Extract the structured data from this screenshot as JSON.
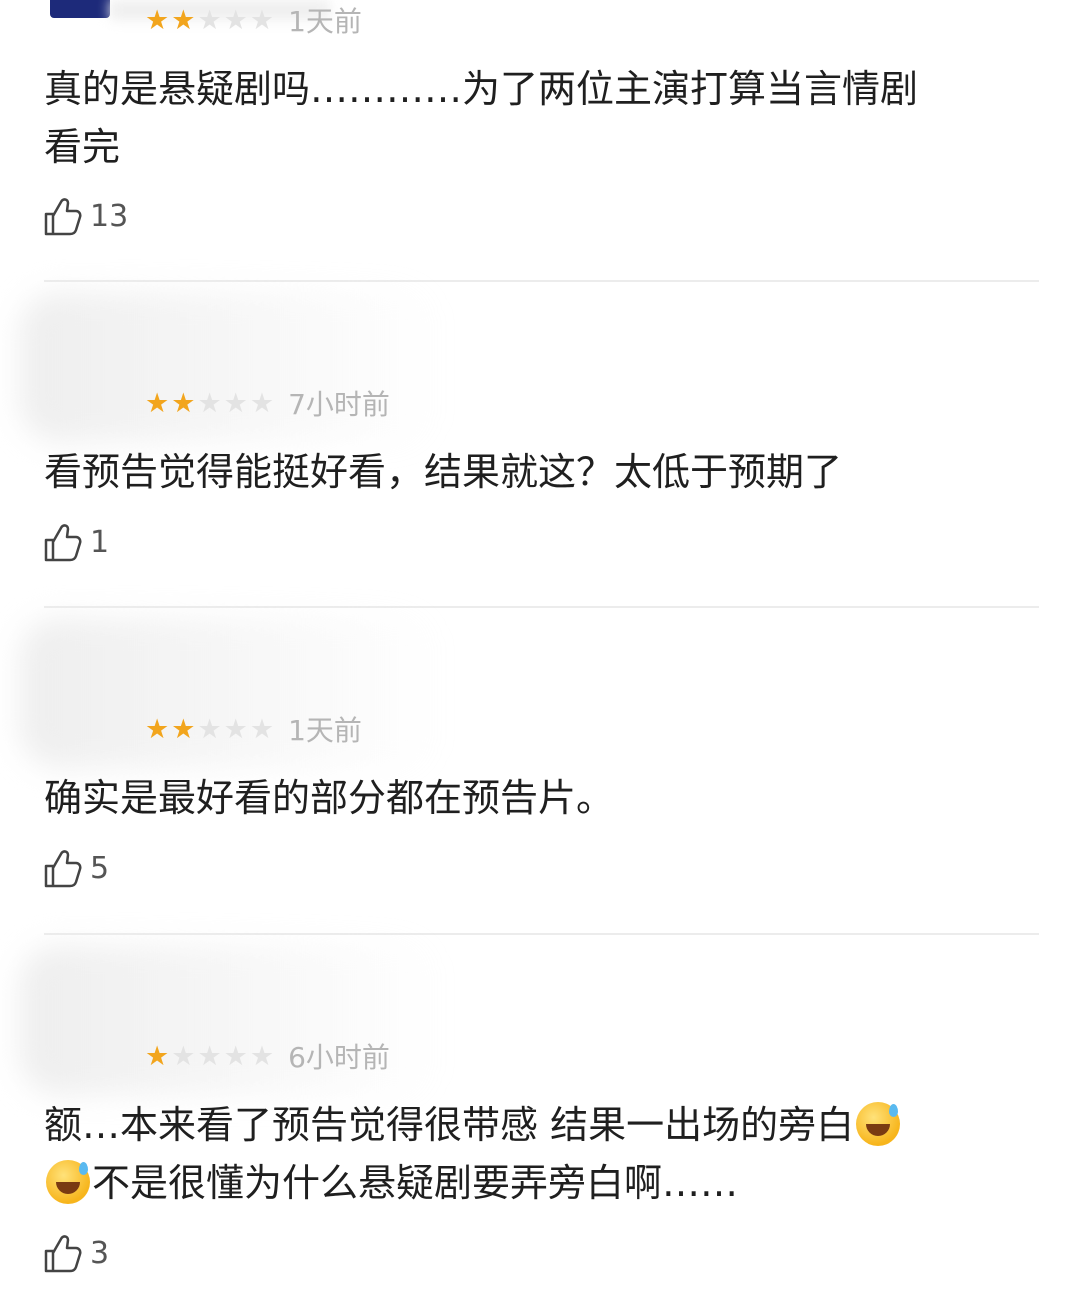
{
  "reviews": [
    {
      "stars": [
        "★",
        "★",
        "★",
        "★",
        "★"
      ],
      "rating": 2,
      "time": "1天前",
      "text_lines": [
        "真的是悬疑剧吗…………为了两位主演打算当言情剧",
        "看完"
      ],
      "likes": "13"
    },
    {
      "stars": [
        "★",
        "★",
        "★",
        "★",
        "★"
      ],
      "rating": 2,
      "time": "7小时前",
      "text_lines": [
        "看预告觉得能挺好看，结果就这？太低于预期了"
      ],
      "likes": "1"
    },
    {
      "stars": [
        "★",
        "★",
        "★",
        "★",
        "★"
      ],
      "rating": 2,
      "time": "1天前",
      "text_lines": [
        "确实是最好看的部分都在预告片。"
      ],
      "likes": "5"
    },
    {
      "stars": [
        "★",
        "★",
        "★",
        "★",
        "★"
      ],
      "rating": 1,
      "time": "6小时前",
      "text_line1_before_emoji": "额…本来看了预告觉得很带感 结果一出场的旁白",
      "text_line2_after_emoji": "不是很懂为什么悬疑剧要弄旁白啊……",
      "emoji_icon": "grinning-sweat-emoji",
      "likes": "3"
    }
  ],
  "colors": {
    "star_on": "#f2a51d",
    "star_off": "#e3e3e3",
    "time": "#b5b5b5",
    "divider": "#ececec"
  },
  "icons": {
    "like": "thumbs-up-icon"
  }
}
